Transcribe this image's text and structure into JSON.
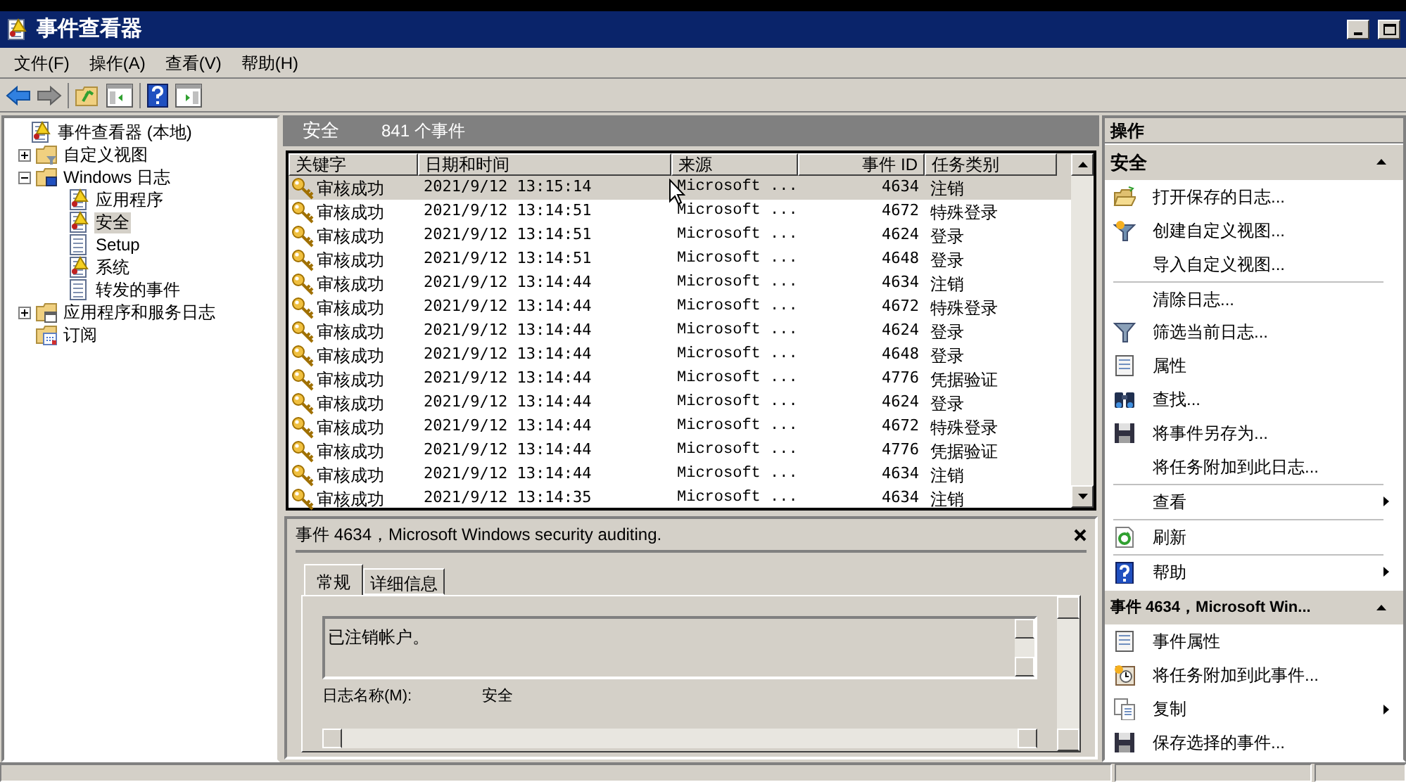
{
  "window": {
    "title": "事件查看器"
  },
  "menu": [
    {
      "label": "文件(F)"
    },
    {
      "label": "操作(A)"
    },
    {
      "label": "查看(V)"
    },
    {
      "label": "帮助(H)"
    }
  ],
  "tree": {
    "label": "事件查看器 (本地)",
    "selected": false,
    "children": [
      {
        "label": "自定义视图",
        "kind": "folder",
        "expanded": false,
        "selected": false
      },
      {
        "label": "Windows 日志",
        "kind": "windows-logs",
        "expanded": true,
        "selected": false,
        "children": [
          {
            "label": "应用程序",
            "kind": "log-warn",
            "selected": false
          },
          {
            "label": "安全",
            "kind": "log-warn",
            "selected": true
          },
          {
            "label": "Setup",
            "kind": "log",
            "selected": false
          },
          {
            "label": "系统",
            "kind": "log-warn",
            "selected": false
          },
          {
            "label": "转发的事件",
            "kind": "log",
            "selected": false
          }
        ]
      },
      {
        "label": "应用程序和服务日志",
        "kind": "folder-app",
        "expanded": false,
        "selected": false
      },
      {
        "label": "订阅",
        "kind": "subscription",
        "selected": false
      }
    ]
  },
  "list_header": {
    "title": "安全",
    "count": "841 个事件"
  },
  "table": {
    "columns": [
      "关键字",
      "日期和时间",
      "来源",
      "事件 ID",
      "任务类别"
    ],
    "rows": [
      {
        "selected": true,
        "cells": [
          "审核成功",
          "2021/9/12 13:15:14",
          "Microsoft ...",
          "4634",
          "注销"
        ]
      },
      {
        "selected": false,
        "cells": [
          "审核成功",
          "2021/9/12 13:14:51",
          "Microsoft ...",
          "4672",
          "特殊登录"
        ]
      },
      {
        "selected": false,
        "cells": [
          "审核成功",
          "2021/9/12 13:14:51",
          "Microsoft ...",
          "4624",
          "登录"
        ]
      },
      {
        "selected": false,
        "cells": [
          "审核成功",
          "2021/9/12 13:14:51",
          "Microsoft ...",
          "4648",
          "登录"
        ]
      },
      {
        "selected": false,
        "cells": [
          "审核成功",
          "2021/9/12 13:14:44",
          "Microsoft ...",
          "4634",
          "注销"
        ]
      },
      {
        "selected": false,
        "cells": [
          "审核成功",
          "2021/9/12 13:14:44",
          "Microsoft ...",
          "4672",
          "特殊登录"
        ]
      },
      {
        "selected": false,
        "cells": [
          "审核成功",
          "2021/9/12 13:14:44",
          "Microsoft ...",
          "4624",
          "登录"
        ]
      },
      {
        "selected": false,
        "cells": [
          "审核成功",
          "2021/9/12 13:14:44",
          "Microsoft ...",
          "4648",
          "登录"
        ]
      },
      {
        "selected": false,
        "cells": [
          "审核成功",
          "2021/9/12 13:14:44",
          "Microsoft ...",
          "4776",
          "凭据验证"
        ]
      },
      {
        "selected": false,
        "cells": [
          "审核成功",
          "2021/9/12 13:14:44",
          "Microsoft ...",
          "4624",
          "登录"
        ]
      },
      {
        "selected": false,
        "cells": [
          "审核成功",
          "2021/9/12 13:14:44",
          "Microsoft ...",
          "4672",
          "特殊登录"
        ]
      },
      {
        "selected": false,
        "cells": [
          "审核成功",
          "2021/9/12 13:14:44",
          "Microsoft ...",
          "4776",
          "凭据验证"
        ]
      },
      {
        "selected": false,
        "cells": [
          "审核成功",
          "2021/9/12 13:14:44",
          "Microsoft ...",
          "4634",
          "注销"
        ]
      },
      {
        "selected": false,
        "cells": [
          "审核成功",
          "2021/9/12 13:14:35",
          "Microsoft ...",
          "4634",
          "注销"
        ]
      }
    ]
  },
  "details": {
    "title": "事件 4634，Microsoft Windows security auditing.",
    "tabs": [
      {
        "label": "常规",
        "selected": true
      },
      {
        "label": "详细信息",
        "selected": false
      }
    ],
    "message": "已注销帐户。",
    "field_label": "日志名称(M):",
    "field_value": "安全"
  },
  "actions": {
    "title": "操作",
    "sections": [
      {
        "title": "安全",
        "expanded": true,
        "items": [
          {
            "kind": "action",
            "label": "打开保存的日志...",
            "submenu": false
          },
          {
            "kind": "action",
            "label": "创建自定义视图...",
            "submenu": false
          },
          {
            "kind": "action",
            "label": "导入自定义视图...",
            "submenu": false
          },
          {
            "kind": "separator"
          },
          {
            "kind": "action",
            "label": "清除日志...",
            "submenu": false
          },
          {
            "kind": "action",
            "label": "筛选当前日志...",
            "submenu": false
          },
          {
            "kind": "action",
            "label": "属性",
            "submenu": false
          },
          {
            "kind": "action",
            "label": "查找...",
            "submenu": false
          },
          {
            "kind": "action",
            "label": "将事件另存为...",
            "submenu": false
          },
          {
            "kind": "action",
            "label": "将任务附加到此日志...",
            "submenu": false
          },
          {
            "kind": "separator"
          },
          {
            "kind": "action",
            "label": "查看",
            "submenu": true
          },
          {
            "kind": "separator"
          },
          {
            "kind": "action",
            "label": "刷新",
            "submenu": false
          },
          {
            "kind": "separator"
          },
          {
            "kind": "action",
            "label": "帮助",
            "submenu": true
          }
        ]
      },
      {
        "title": "事件 4634，Microsoft Win...",
        "expanded": true,
        "items": [
          {
            "kind": "action",
            "label": "事件属性",
            "submenu": false
          },
          {
            "kind": "action",
            "label": "将任务附加到此事件...",
            "submenu": false
          },
          {
            "kind": "action",
            "label": "复制",
            "submenu": true
          },
          {
            "kind": "action",
            "label": "保存选择的事件...",
            "submenu": false
          }
        ]
      }
    ]
  }
}
